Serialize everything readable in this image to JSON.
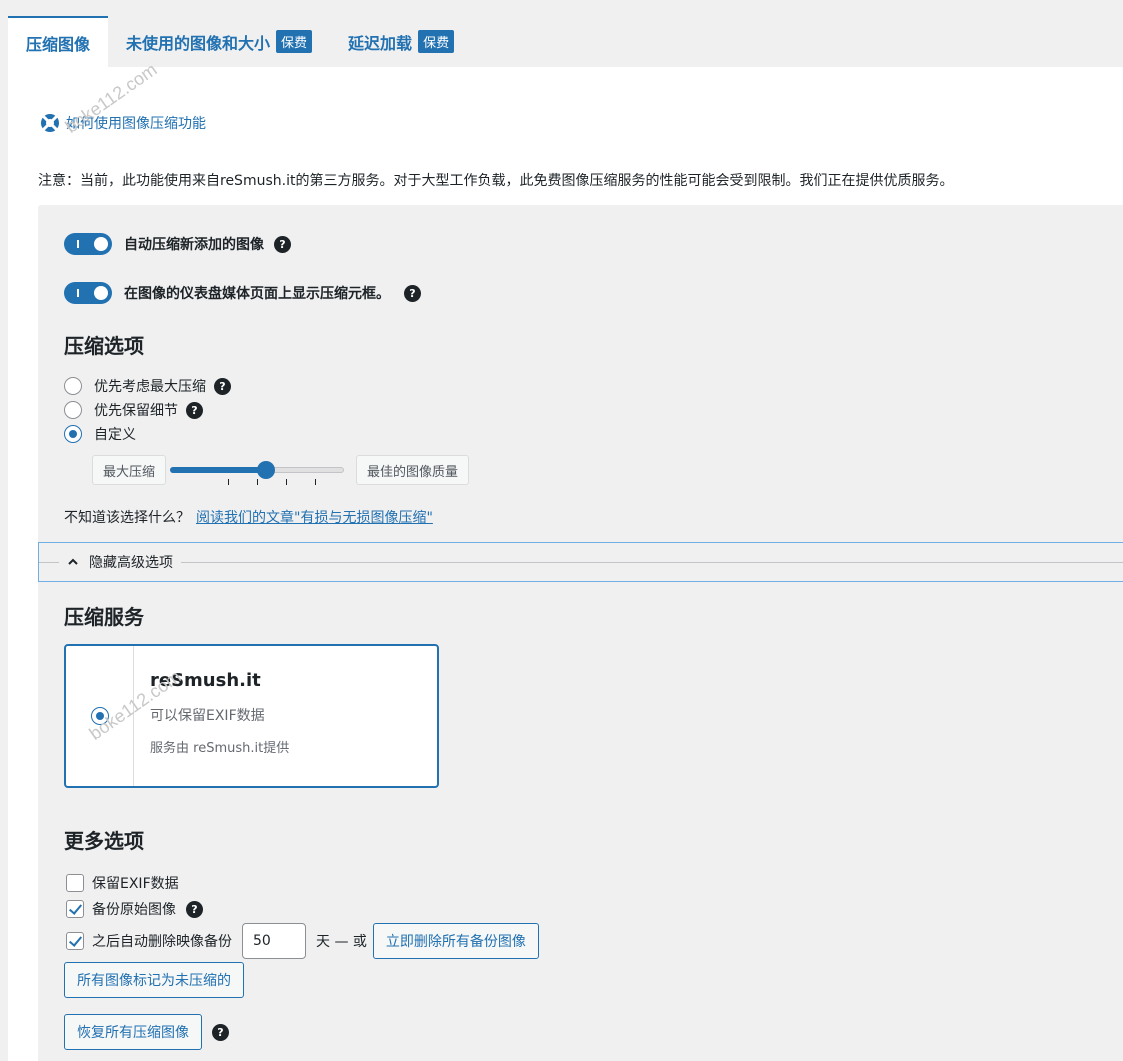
{
  "tabs": [
    {
      "label": "压缩图像",
      "badge": ""
    },
    {
      "label": "未使用的图像和大小",
      "badge": "保费"
    },
    {
      "label": "延迟加载",
      "badge": "保费"
    }
  ],
  "howto_link": "如何使用图像压缩功能",
  "notice": "注意：当前，此功能使用来自reSmush.it的第三方服务。对于大型工作负载，此免费图像压缩服务的性能可能会受到限制。我们正在提供优质服务。",
  "toggles": [
    {
      "label": "自动压缩新添加的图像",
      "on": true
    },
    {
      "label": "在图像的仪表盘媒体页面上显示压缩元框。",
      "on": true
    }
  ],
  "compression": {
    "title": "压缩选项",
    "options": [
      "优先考虑最大压缩",
      "优先保留细节",
      "自定义"
    ],
    "selected": 2,
    "slider_min_label": "最大压缩",
    "slider_max_label": "最佳的图像质量",
    "slider_value": 0.55,
    "help_text": "不知道该选择什么？",
    "help_link": "阅读我们的文章\"有损与无损图像压缩\""
  },
  "advanced_toggle": "隐藏高级选项",
  "service": {
    "title": "压缩服务",
    "name": "reSmush.it",
    "feature": "可以保留EXIF数据",
    "provider": "服务由 reSmush.it提供"
  },
  "more": {
    "title": "更多选项",
    "keep_exif": "保留EXIF数据",
    "backup": "备份原始图像",
    "auto_delete": "之后自动删除映像备份",
    "days_value": "50",
    "days_suffix": "天 — 或",
    "delete_all_button": "立即删除所有备份图像",
    "mark_uncompressed_button": "所有图像标记为未压缩的",
    "restore_button": "恢复所有压缩图像"
  },
  "watermark": "boke112.com",
  "colors": {
    "accent": "#2271b1",
    "background": "#f0f0f1"
  }
}
